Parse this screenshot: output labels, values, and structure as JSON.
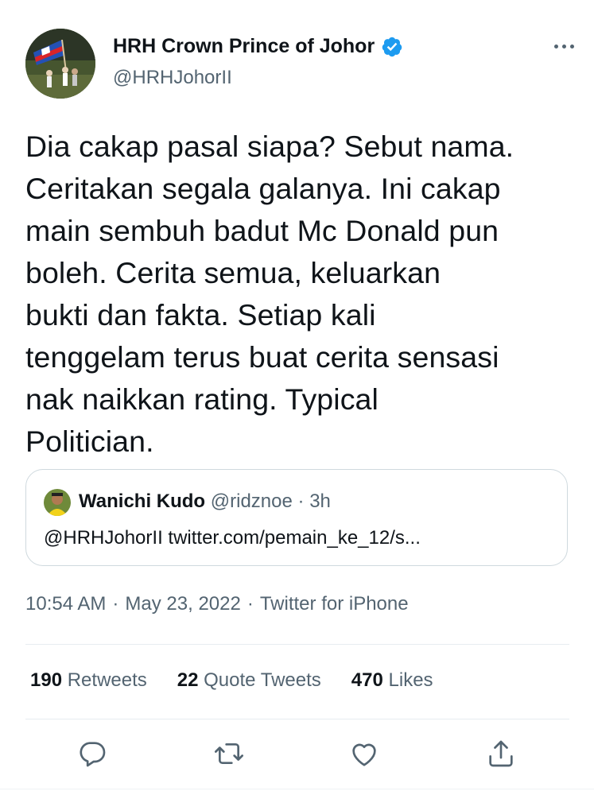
{
  "author": {
    "name": "HRH Crown Prince of Johor",
    "handle": "@HRHJohorII",
    "verified": true
  },
  "tweet": {
    "text": "Dia cakap pasal siapa? Sebut nama.\nCeritakan segala galanya. Ini cakap\nmain sembuh badut Mc Donald pun\nboleh. Cerita semua, keluarkan\nbukti dan fakta. Setiap kali\ntenggelam terus buat cerita sensasi\nnak naikkan rating. Typical\nPolitician."
  },
  "quoted_tweet": {
    "name": "Wanichi Kudo",
    "handle": "@ridznoe",
    "separator": "·",
    "time": "3h",
    "text": "@HRHJohorII twitter.com/pemain_ke_12/s..."
  },
  "meta": {
    "time": "10:54 AM",
    "date": "May 23, 2022",
    "source": "Twitter for iPhone",
    "separator": "·"
  },
  "stats": {
    "retweets_count": "190",
    "retweets_label": "Retweets",
    "quotes_count": "22",
    "quotes_label": "Quote Tweets",
    "likes_count": "470",
    "likes_label": "Likes"
  },
  "icons": {
    "more": "more-horizontal-icon",
    "reply": "reply-icon",
    "retweet": "retweet-icon",
    "like": "heart-icon",
    "share": "share-icon",
    "verified": "verified-badge-icon"
  },
  "colors": {
    "text": "#0f1419",
    "secondary": "#536471",
    "verified": "#1d9bf0",
    "border": "#cfd9de"
  }
}
